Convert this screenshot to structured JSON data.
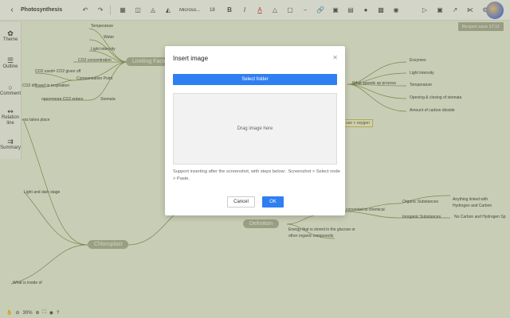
{
  "toolbar": {
    "back_icon": "chevron-left-icon",
    "title": "Photosynthesis",
    "font": "Microso...",
    "size": "18",
    "bold": "B",
    "italic": "I"
  },
  "resave_label": "Reopen save 17:11",
  "left_panel": [
    {
      "label": "Theme",
      "icon": "theme-icon"
    },
    {
      "label": "Outline",
      "icon": "outline-icon"
    },
    {
      "label": "Comment",
      "icon": "comment-icon"
    },
    {
      "label": "Relation line",
      "icon": "relation-icon"
    },
    {
      "label": "Summary",
      "icon": "summary-icon"
    }
  ],
  "zoom": "30%",
  "mindmap": {
    "left_items": [
      "Temperature",
      "Water",
      "Light intensity",
      "CO2 concentration",
      "Compensation Point",
      "Stomata"
    ],
    "left_labels": [
      "CO2 used= CO2 given off",
      "CO2 diffused in respiration",
      "open=more CO2 enters"
    ],
    "limiting": "Limiting Facto",
    "speeds": "What speeds up process",
    "speed_items": [
      "Enzymes",
      "Light intensity",
      "Temperature",
      "Opening & closing of stomata",
      "Amount of carbon dioxide"
    ],
    "takes_place": "ess takes place",
    "light_dark": "Light and dark stage",
    "chloroplast": "Chloroplast",
    "inside": "What is inside of",
    "oxygen_box": "ose + oxygen",
    "converted": "converted to chemical",
    "organic": "Organic Substances",
    "inorganic": "Inorganic Substances",
    "organic_desc": [
      "Anything linked with",
      "Hydrogen and Carbon"
    ],
    "inorganic_desc": "No Carbon and Hydrogen Sp",
    "definition": "Definition",
    "energy": [
      "Energy that is stored in the glucose or",
      "other organic compounds"
    ]
  },
  "modal": {
    "title": "Insert image",
    "select_folder": "Select folder",
    "drop_text": "Drag image here",
    "hint": "Support inserting after the screenshot, with steps below:. Screenshot > Select node > Paste.",
    "cancel": "Cancel",
    "ok": "OK"
  }
}
